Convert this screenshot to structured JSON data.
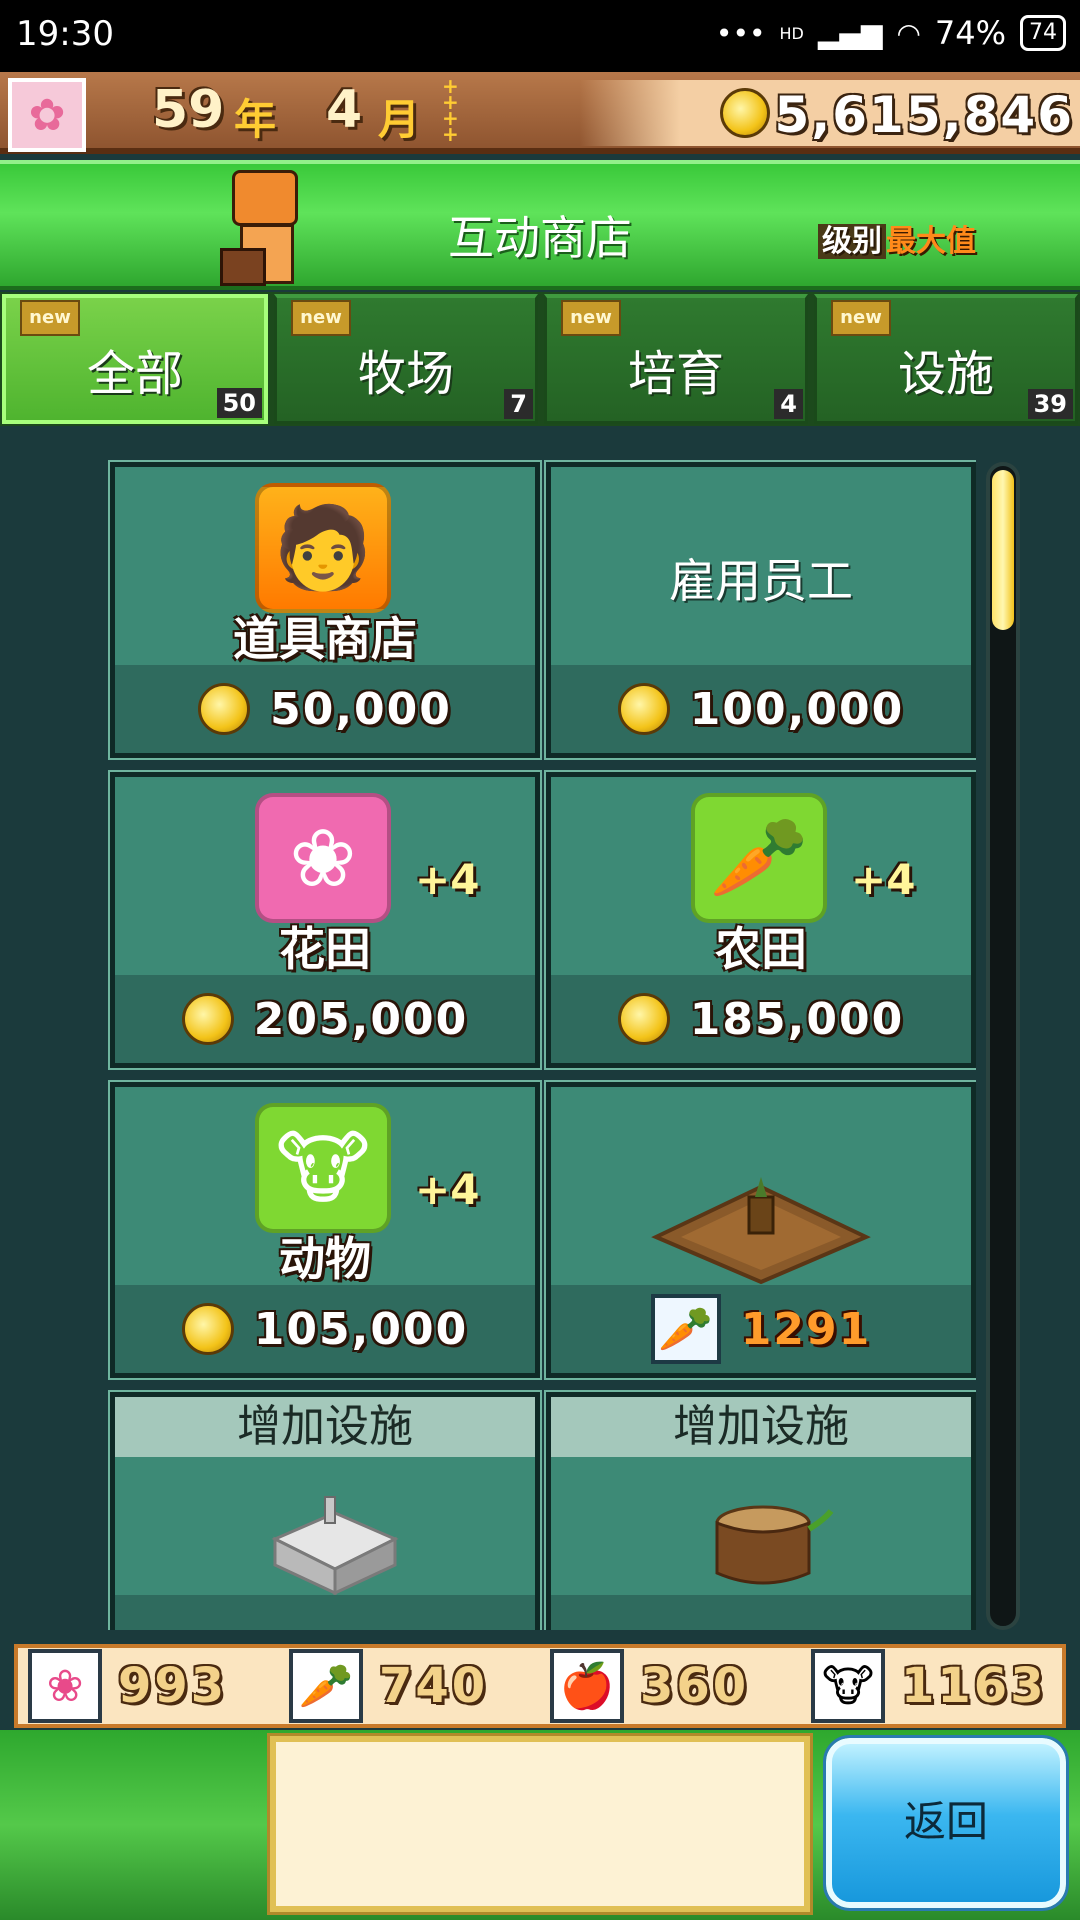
{
  "status": {
    "time": "19:30",
    "network": "HD",
    "battery_text": "74%",
    "battery_icon": "74"
  },
  "header": {
    "year": "59",
    "year_unit": "年",
    "month": "4",
    "month_unit": "月",
    "money": "5,615,846"
  },
  "shop": {
    "title": "互动商店",
    "level_label": "级别",
    "level_value": "最大值"
  },
  "tabs": [
    {
      "label": "全部",
      "count": "50",
      "badge": "new"
    },
    {
      "label": "牧场",
      "count": "7",
      "badge": "new"
    },
    {
      "label": "培育",
      "count": "4",
      "badge": "new"
    },
    {
      "label": "设施",
      "count": "39",
      "badge": "new"
    }
  ],
  "cards": [
    {
      "name": "道具商店",
      "price": "50,000",
      "icon": "shopkeeper-icon"
    },
    {
      "name": "雇用员工",
      "price": "100,000"
    },
    {
      "name": "花田",
      "bonus": "+4",
      "price": "205,000",
      "icon": "tulip-icon",
      "color": "#f06ab0"
    },
    {
      "name": "农田",
      "bonus": "+4",
      "price": "185,000",
      "icon": "carrot-icon",
      "color": "#7fd832"
    },
    {
      "name": "动物",
      "bonus": "+4",
      "price": "105,000",
      "icon": "cow-icon",
      "color": "#7fd832"
    },
    {
      "price": "1291",
      "icon": "carrot-icon"
    },
    {
      "title": "增加设施"
    },
    {
      "title": "增加设施"
    }
  ],
  "resources": [
    {
      "icon": "tulip-icon",
      "value": "993"
    },
    {
      "icon": "carrot-icon",
      "value": "740"
    },
    {
      "icon": "apple-icon",
      "value": "360"
    },
    {
      "icon": "cow-icon",
      "value": "1163"
    }
  ],
  "footer": {
    "message": "",
    "back_label": "返回"
  }
}
